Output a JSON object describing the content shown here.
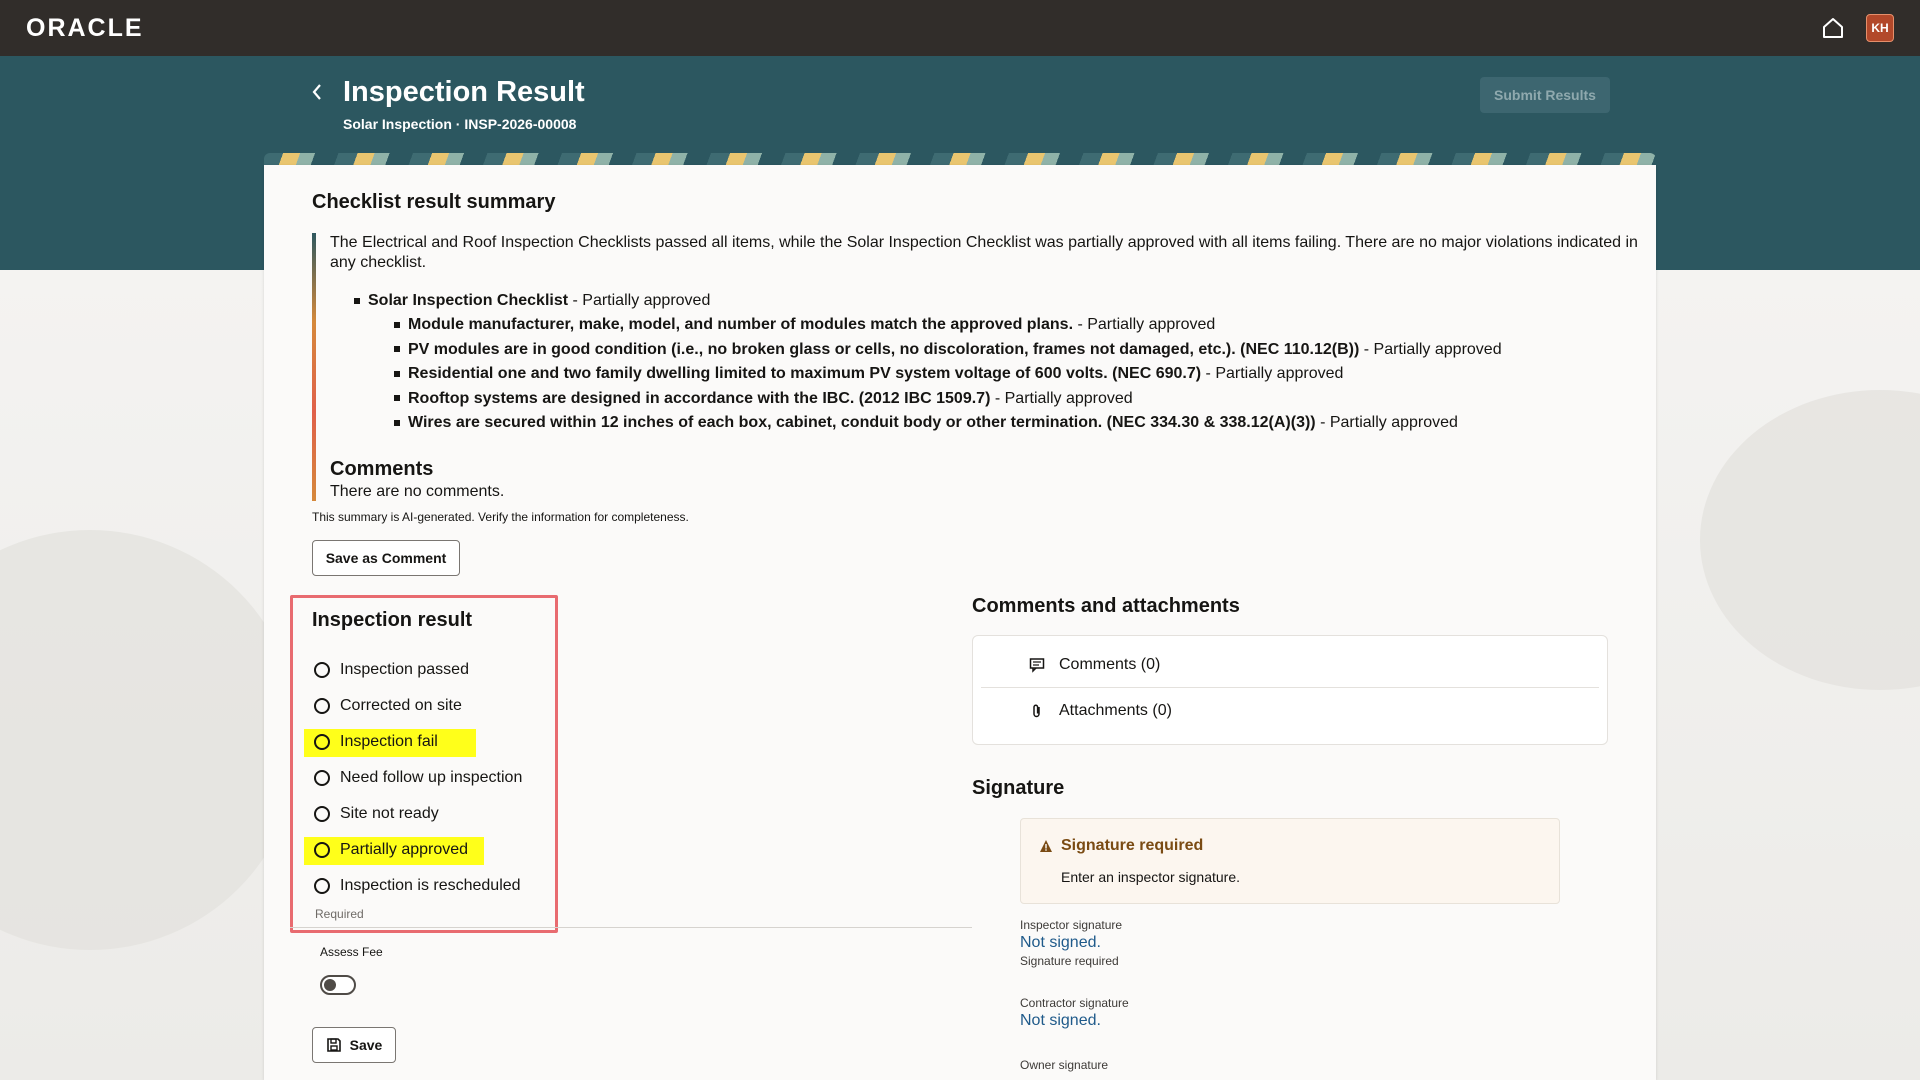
{
  "topbar": {
    "logo": "ORACLE",
    "avatar_initials": "KH",
    "home_icon": "home-icon"
  },
  "header": {
    "title": "Inspection Result",
    "subtitle": "Solar Inspection · INSP-2026-00008",
    "submit_label": "Submit Results"
  },
  "summary": {
    "title": "Checklist result summary",
    "intro": "The Electrical and Roof Inspection Checklists passed all items, while the Solar Inspection Checklist was partially approved with all items failing. There are no major violations indicated in any checklist.",
    "checklist": {
      "name": "Solar Inspection Checklist",
      "status": " - Partially approved",
      "items": [
        {
          "text": "Module manufacturer, make, model, and number of modules match the approved plans.",
          "status": " - Partially approved"
        },
        {
          "text": "PV modules are in good condition (i.e., no broken glass or cells, no discoloration, frames not damaged, etc.). (NEC 110.12(B))",
          "status": " - Partially approved"
        },
        {
          "text": "Residential one and two family dwelling limited to maximum PV system voltage of 600 volts. (NEC 690.7)",
          "status": " - Partially approved"
        },
        {
          "text": "Rooftop systems are designed in accordance with the IBC. (2012 IBC 1509.7)",
          "status": " - Partially approved"
        },
        {
          "text": "Wires are secured within 12 inches of each box, cabinet, conduit body or other termination. (NEC 334.30 & 338.12(A)(3))",
          "status": " - Partially approved"
        }
      ]
    },
    "comments_heading": "Comments",
    "comments_text": "There are no comments.",
    "ai_note": "This summary is AI-generated. Verify the information for completeness.",
    "save_comment_label": "Save as Comment"
  },
  "inspection_result": {
    "title": "Inspection result",
    "options": [
      {
        "label": "Inspection passed",
        "highlighted": false
      },
      {
        "label": "Corrected on site",
        "highlighted": false
      },
      {
        "label": "Inspection fail",
        "highlighted": true
      },
      {
        "label": "Need follow up inspection",
        "highlighted": false
      },
      {
        "label": "Site not ready",
        "highlighted": false
      },
      {
        "label": "Partially approved",
        "highlighted": true
      },
      {
        "label": "Inspection is rescheduled",
        "highlighted": false
      }
    ],
    "required_note": "Required",
    "highlight_color": "#ffff1a",
    "frame_color": "#e86b70"
  },
  "fee": {
    "label": "Assess Fee",
    "toggle_on": false
  },
  "save_label": "Save",
  "comments_attachments": {
    "title": "Comments and attachments",
    "comments_label": "Comments (0)",
    "attachments_label": "Attachments (0)"
  },
  "signature": {
    "title": "Signature",
    "alert_title": "Signature required",
    "alert_text": "Enter an inspector signature.",
    "inspector_label": "Inspector signature",
    "inspector_value": "Not signed.",
    "inspector_sub": "Signature required",
    "contractor_label": "Contractor signature",
    "contractor_value": "Not signed.",
    "owner_label": "Owner signature"
  },
  "colors": {
    "topbar": "#312d2a",
    "band": "#2c5760",
    "link": "#1f5a8a"
  }
}
